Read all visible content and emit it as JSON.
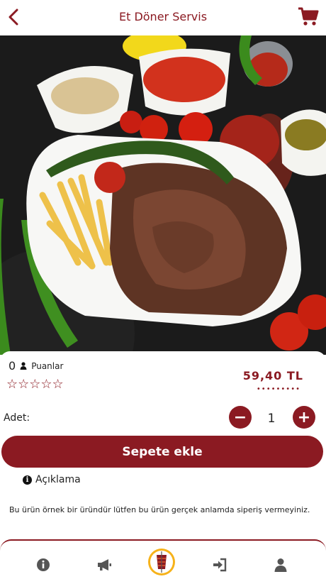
{
  "header": {
    "title": "Et Döner Servis",
    "back_icon": "chevron-left-icon",
    "cart_icon": "shopping-cart-icon"
  },
  "product": {
    "points_value": "0",
    "points_label": "Puanlar",
    "stars": "☆☆☆☆☆",
    "rating": 0,
    "price": "59,40 TL",
    "price_dots": "•••••••••"
  },
  "quantity": {
    "label": "Adet:",
    "value": "1",
    "minus": "−",
    "plus": "+"
  },
  "add_button": {
    "label": "Sepete ekle"
  },
  "description": {
    "heading": "Açıklama",
    "text": "Bu ürün örnek bir üründür lütfen bu ürün gerçek anlamda siperiş vermeyiniz."
  },
  "tabbar": {
    "items": [
      "info-icon",
      "megaphone-icon",
      "brand-logo",
      "login-icon",
      "user-icon"
    ]
  },
  "colors": {
    "accent": "#8b1a22",
    "background": "#ffffff",
    "photo_bg": "#1b1b1b"
  }
}
